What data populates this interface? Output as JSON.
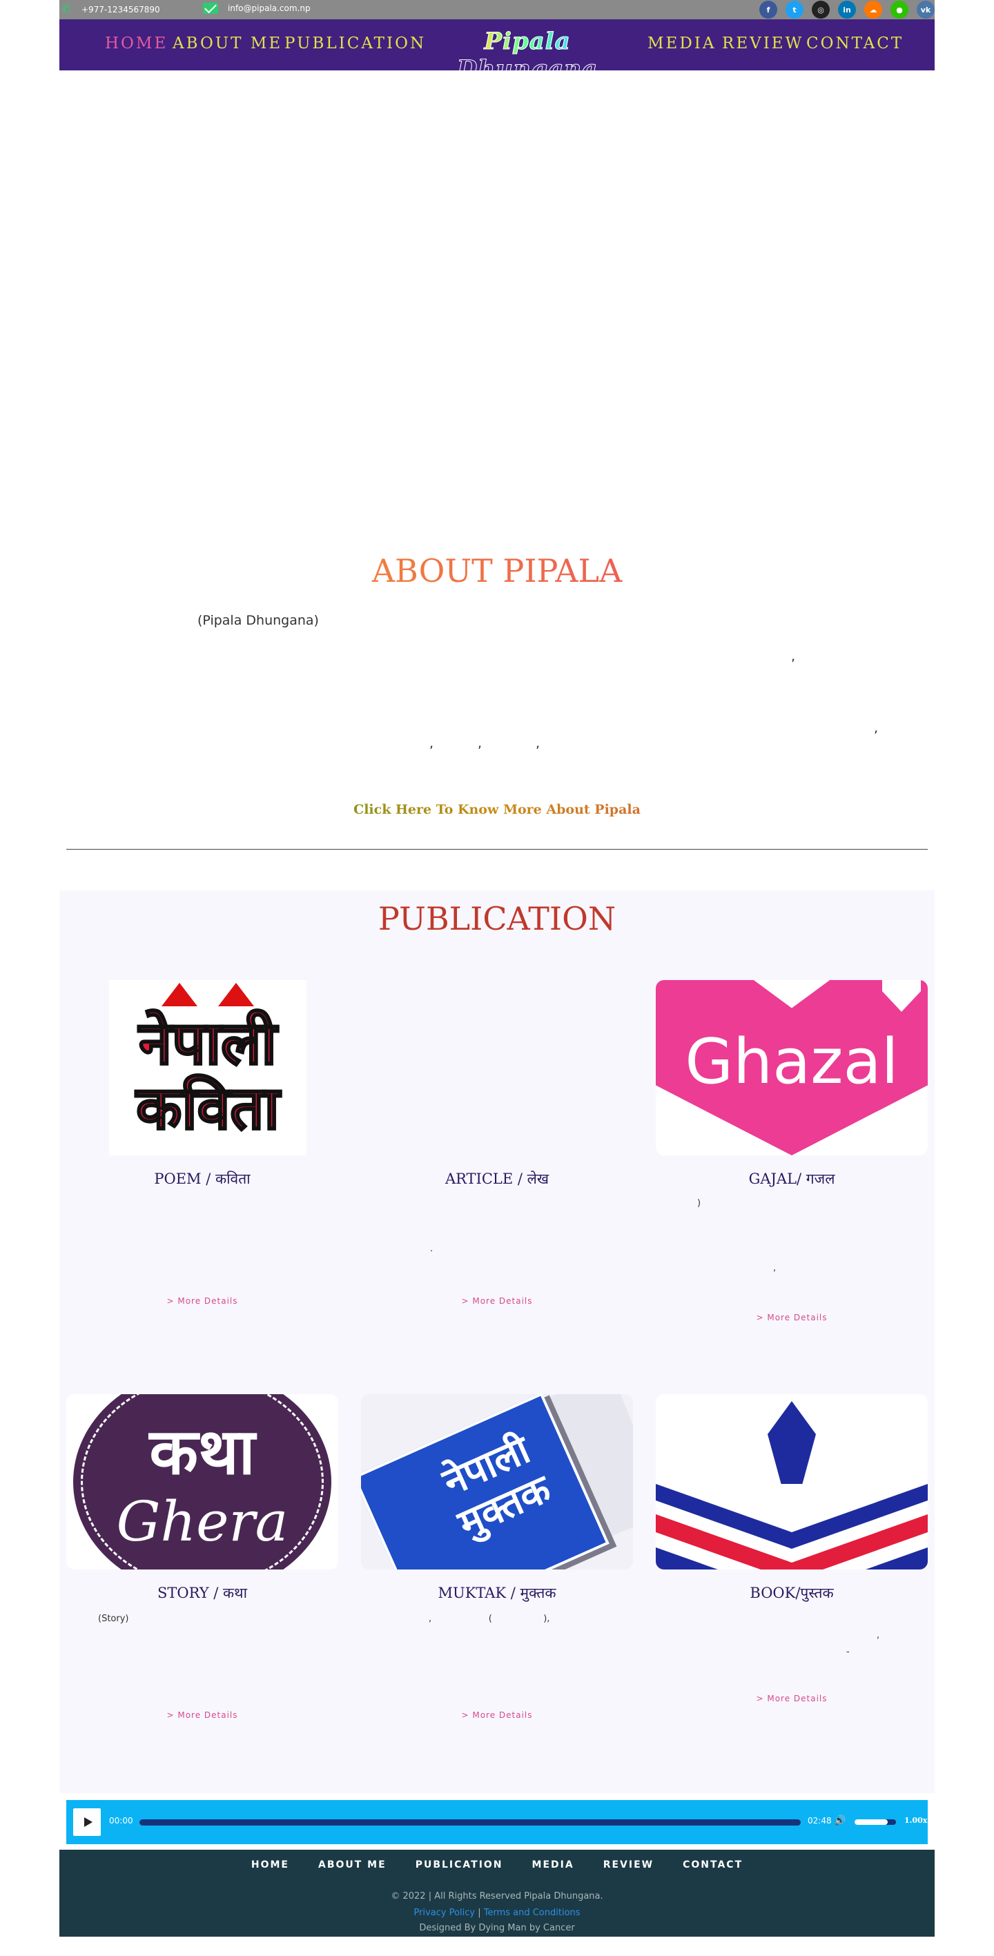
{
  "topbar": {
    "phone": "+977-1234567890",
    "email": "info@pipala.com.np",
    "socials": [
      {
        "icon": "facebook-icon",
        "glyph": "f",
        "color": "#3b5998"
      },
      {
        "icon": "twitter-icon",
        "glyph": "t",
        "color": "#1da1f2"
      },
      {
        "icon": "instagram-icon",
        "glyph": "◎",
        "color": "#222222"
      },
      {
        "icon": "linkedin-icon",
        "glyph": "in",
        "color": "#0077b5"
      },
      {
        "icon": "soundcloud-icon",
        "glyph": "☁",
        "color": "#ff7700"
      },
      {
        "icon": "wechat-icon",
        "glyph": "●",
        "color": "#2dc100"
      },
      {
        "icon": "vk-icon",
        "glyph": "vk",
        "color": "#4a76a8"
      }
    ]
  },
  "nav": {
    "home": "HOME",
    "about": "ABOUT ME",
    "publication": "PUBLICATION",
    "logo": "Pipala Dhungana",
    "media": "MEDIA",
    "review": "REVIEW",
    "contact": "CONTACT"
  },
  "about": {
    "title": "ABOUT PIPALA",
    "name_line": "(Pipala Dhungana)",
    "comma1": ",",
    "comma2": ",",
    "comma3": ",",
    "comma4": ",",
    "comma5": ",",
    "more_link": "Click Here To Know More About Pipala"
  },
  "publication": {
    "title": "PUBLICATION",
    "cards": [
      {
        "title": "POEM / कविता",
        "desc": "",
        "more": "> More Details",
        "art_l1": "नेपाली",
        "art_l2": "कविता"
      },
      {
        "title": "ARTICLE / लेख",
        "desc": ".",
        "more": "> More Details"
      },
      {
        "title": "GAJAL/ गजल",
        "desc": ")",
        "desc2": ",",
        "more": "> More Details",
        "art": "Ghazal"
      },
      {
        "title": "STORY / कथा",
        "desc": "(Story)",
        "more": "> More Details",
        "art_l1": "कथा",
        "art_l2": "Ghera"
      },
      {
        "title": "MUKTAK / मुक्तक",
        "desc": ",                    (                  ),",
        "more": "> More Details",
        "art": "नेपाली मुक्तक"
      },
      {
        "title": "BOOK/पुस्तक",
        "desc": ",",
        "desc2": "-",
        "more": "> More Details"
      }
    ]
  },
  "audio": {
    "current_time": "00:00",
    "duration": "02:48",
    "progress": 0,
    "volume": 0.8,
    "speed": "1.00x"
  },
  "footer": {
    "nav": [
      "HOME",
      "ABOUT ME",
      "PUBLICATION",
      "MEDIA",
      "REVIEW",
      "CONTACT"
    ],
    "copyright": "© 2022 | All Rights Reserved Pipala Dhungana.",
    "privacy": "Privacy Policy",
    "separator": "|",
    "terms": "Terms and Conditions",
    "designed": "Designed By Dying Man by Cancer"
  }
}
